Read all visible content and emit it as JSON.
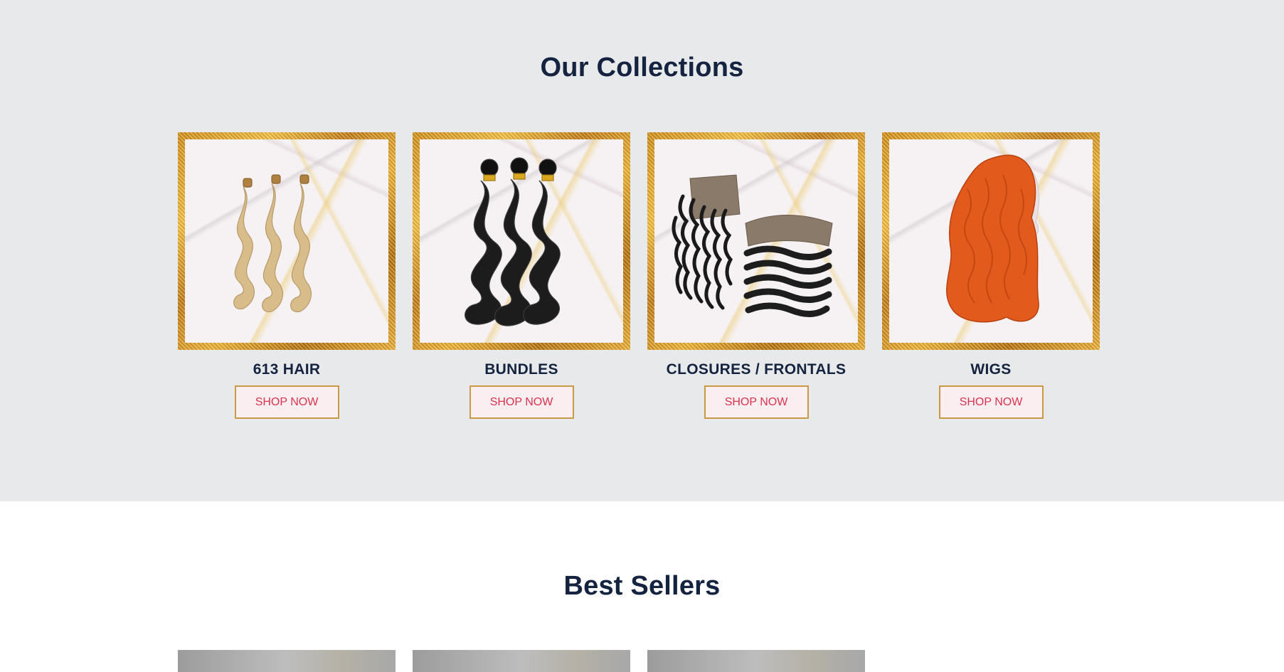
{
  "collections": {
    "title": "Our Collections",
    "items": [
      {
        "label": "613 HAIR",
        "button": "SHOP NOW",
        "image_icon": "blonde-bundles-image",
        "color": "#d9bf8c"
      },
      {
        "label": "BUNDLES",
        "button": "SHOP NOW",
        "image_icon": "black-bundles-image",
        "color": "#1b1b1b"
      },
      {
        "label": "CLOSURES / FRONTALS",
        "button": "SHOP NOW",
        "image_icon": "closure-frontal-image",
        "color": "#1f1f1f"
      },
      {
        "label": "WIGS",
        "button": "SHOP NOW",
        "image_icon": "orange-wig-image",
        "color": "#e35a1e"
      }
    ]
  },
  "best_sellers": {
    "title": "Best Sellers"
  },
  "colors": {
    "heading": "#14233f",
    "button_text": "#d8324f",
    "button_border": "#c99a44",
    "button_bg": "#fbeef1",
    "collections_bg": "#e8e9eb",
    "frame_gold": "#d9a030"
  }
}
